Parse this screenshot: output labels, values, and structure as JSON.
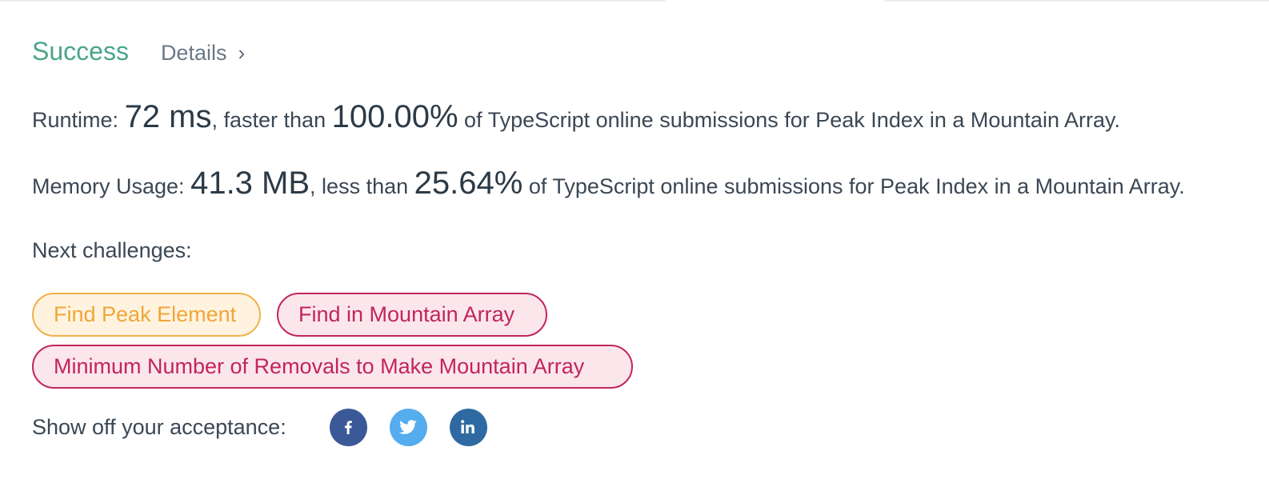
{
  "status": {
    "result": "Success",
    "details_label": "Details",
    "chevron": "›"
  },
  "runtime": {
    "label": "Runtime:",
    "value": "72 ms",
    "comparison": ", faster than",
    "percent": "100.00%",
    "suffix": "of TypeScript online submissions for Peak Index in a Mountain Array."
  },
  "memory": {
    "label": "Memory Usage:",
    "value": "41.3 MB",
    "comparison": ", less than",
    "percent": "25.64%",
    "suffix": "of TypeScript online submissions for Peak Index in a Mountain Array."
  },
  "next_challenges": {
    "label": "Next challenges:",
    "items": [
      {
        "label": "Find Peak Element",
        "difficulty": "medium"
      },
      {
        "label": "Find in Mountain Array",
        "difficulty": "hard"
      },
      {
        "label": "Minimum Number of Removals to Make Mountain Array",
        "difficulty": "hard"
      }
    ]
  },
  "share": {
    "label": "Show off your acceptance:",
    "icons": [
      "facebook-icon",
      "twitter-icon",
      "linkedin-icon"
    ]
  },
  "colors": {
    "success": "#4aa58c",
    "medium": "#f0a637",
    "hard": "#c2255c",
    "facebook": "#3b5998",
    "twitter": "#55acee",
    "linkedin": "#2e6aa1"
  }
}
